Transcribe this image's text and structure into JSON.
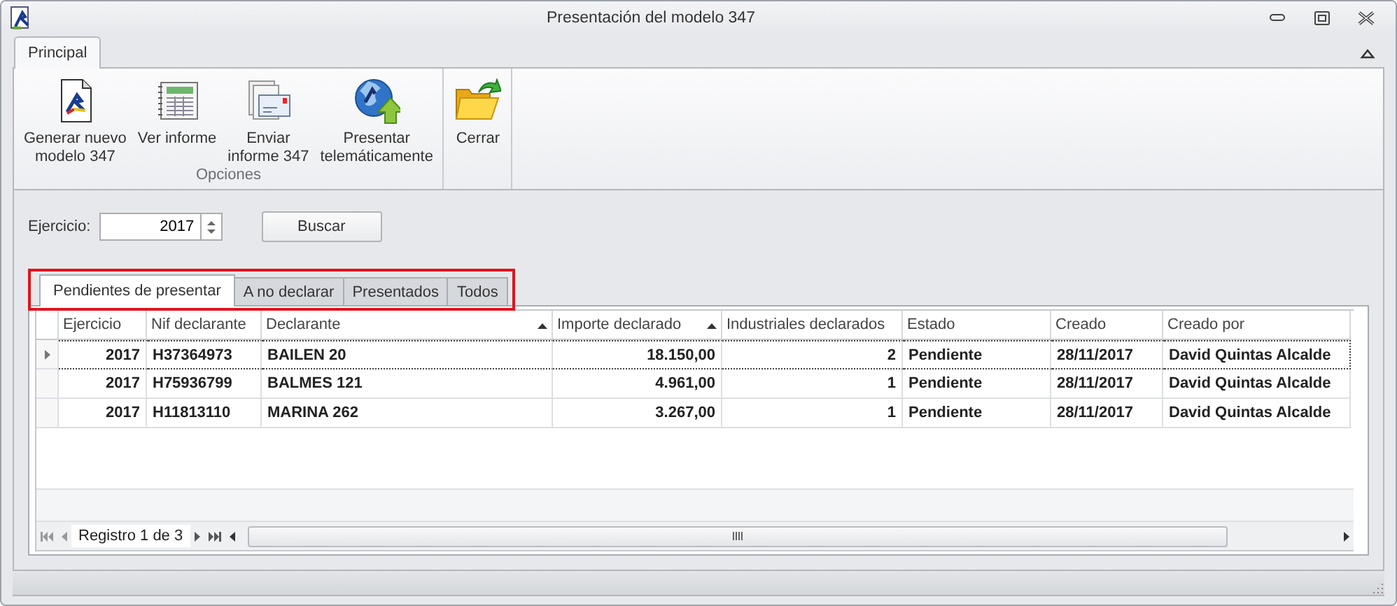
{
  "window": {
    "title": "Presentación del modelo 347"
  },
  "ribbon": {
    "tabs": [
      {
        "label": "Principal",
        "selected": true
      }
    ],
    "groups": [
      {
        "caption": "Opciones",
        "buttons": [
          {
            "label": "Generar nuevo\nmodelo 347"
          },
          {
            "label": "Ver informe"
          },
          {
            "label": "Enviar\ninforme 347"
          },
          {
            "label": "Presentar\ntelemáticamente"
          }
        ]
      },
      {
        "buttons": [
          {
            "label": "Cerrar"
          }
        ]
      }
    ]
  },
  "filter": {
    "label": "Ejercicio:",
    "value": "2017",
    "button": "Buscar"
  },
  "result_tabs": {
    "highlighted": true,
    "tabs": [
      {
        "label": "Pendientes de presentar",
        "selected": true
      },
      {
        "label": "A no declarar",
        "selected": false
      },
      {
        "label": "Presentados",
        "selected": false
      },
      {
        "label": "Todos",
        "selected": false
      }
    ]
  },
  "table": {
    "columns": [
      {
        "label": "Ejercicio",
        "kind": "number",
        "sorted": false
      },
      {
        "label": "Nif declarante",
        "kind": "text",
        "sorted": false
      },
      {
        "label": "Declarante",
        "kind": "text",
        "sorted": true
      },
      {
        "label": "Importe declarado",
        "kind": "number",
        "sorted": true
      },
      {
        "label": "Industriales declarados",
        "kind": "number",
        "sorted": false
      },
      {
        "label": "Estado",
        "kind": "text",
        "sorted": false
      },
      {
        "label": "Creado",
        "kind": "text",
        "sorted": false
      },
      {
        "label": "Creado por",
        "kind": "text",
        "sorted": false
      }
    ],
    "rows": [
      {
        "selected": true,
        "cells": [
          "2017",
          "H37364973",
          "BAILEN 20",
          "18.150,00",
          "2",
          "Pendiente",
          "28/11/2017",
          "David Quintas Alcalde"
        ]
      },
      {
        "selected": false,
        "cells": [
          "2017",
          "H75936799",
          "BALMES 121",
          "4.961,00",
          "1",
          "Pendiente",
          "28/11/2017",
          "David Quintas Alcalde"
        ]
      },
      {
        "selected": false,
        "cells": [
          "2017",
          "H11813110",
          "MARINA 262",
          "3.267,00",
          "1",
          "Pendiente",
          "28/11/2017",
          "David Quintas Alcalde"
        ]
      }
    ]
  },
  "navigator": {
    "text": "Registro 1 de 3"
  }
}
